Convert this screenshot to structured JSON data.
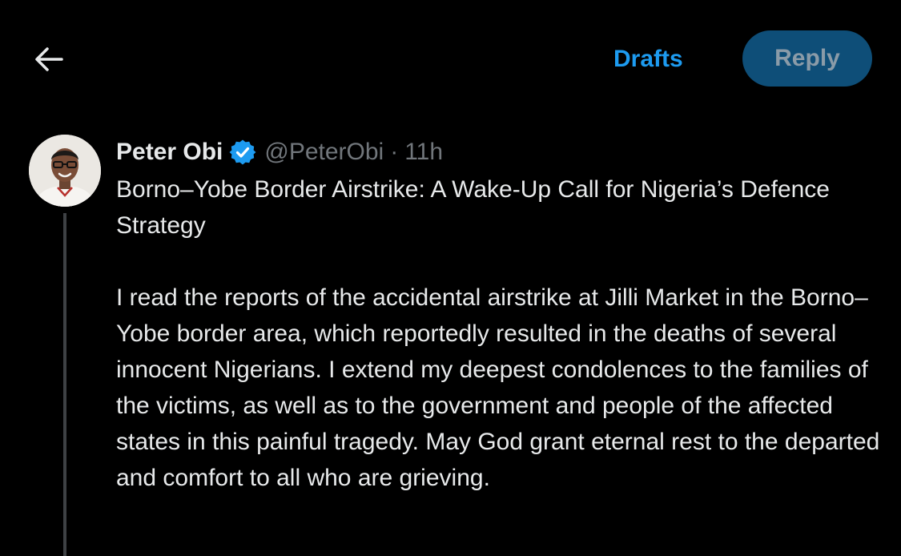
{
  "header": {
    "drafts_label": "Drafts",
    "reply_label": "Reply"
  },
  "icons": {
    "back": "back-arrow-icon",
    "verified": "verified-badge-icon"
  },
  "colors": {
    "accent": "#1d9bf0",
    "reply_button_bg": "#0e4e78",
    "background": "#000000",
    "secondary_text": "#71767b"
  },
  "post": {
    "author_name": "Peter Obi",
    "handle": "@PeterObi",
    "separator": "·",
    "time": "11h",
    "title": "Borno–Yobe Border Airstrike: A Wake-Up Call for Nigeria’s Defence Strategy",
    "body": "I read the reports of the accidental airstrike at Jilli Market in the Borno–Yobe border area, which reportedly resulted in the deaths of several innocent Nigerians. I extend my deepest condolences to the families of the victims, as well as to the government and people of the affected states in this painful tragedy. May God grant eternal rest to the departed and comfort to all who are grieving."
  }
}
